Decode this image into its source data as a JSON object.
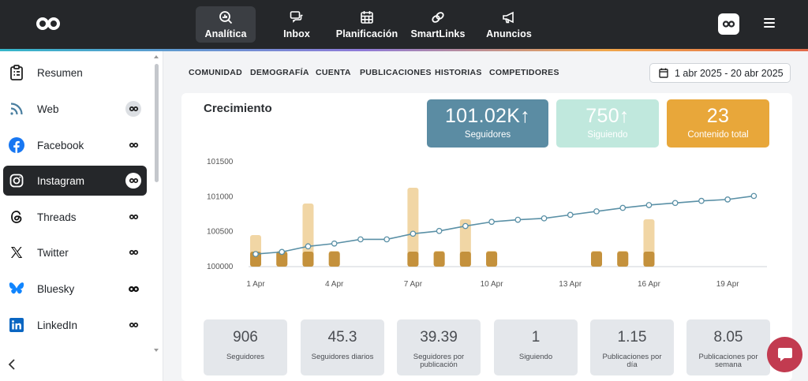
{
  "topnav": {
    "items": [
      {
        "label": "Analítica",
        "icon": "analytics-icon",
        "active": true
      },
      {
        "label": "Inbox",
        "icon": "inbox-icon"
      },
      {
        "label": "Planificación",
        "icon": "calendar-icon"
      },
      {
        "label": "SmartLinks",
        "icon": "link-icon"
      },
      {
        "label": "Anuncios",
        "icon": "megaphone-icon"
      }
    ]
  },
  "sidebar": {
    "items": [
      {
        "label": "Resumen",
        "icon": "clipboard-icon"
      },
      {
        "label": "Web",
        "icon": "rss-icon"
      },
      {
        "label": "Facebook",
        "icon": "facebook-icon"
      },
      {
        "label": "Instagram",
        "icon": "instagram-icon",
        "active": true
      },
      {
        "label": "Threads",
        "icon": "threads-icon"
      },
      {
        "label": "Twitter",
        "icon": "x-icon"
      },
      {
        "label": "Bluesky",
        "icon": "bluesky-icon"
      },
      {
        "label": "LinkedIn",
        "icon": "linkedin-icon"
      }
    ]
  },
  "subnav": {
    "tabs": [
      "COMUNIDAD",
      "DEMOGRAFÍA",
      "CUENTA",
      "PUBLICACIONES",
      "HISTORIAS",
      "COMPETIDORES"
    ],
    "date_range": "1 abr 2025 - 20 abr 2025"
  },
  "growth": {
    "title": "Crecimiento",
    "metrics": [
      {
        "value": "101.02K",
        "label": "Seguidores",
        "color": "#5b8ca3"
      },
      {
        "value": "750",
        "label": "Siguiendo",
        "color": "#c0e8dd"
      },
      {
        "value": "23",
        "label": "Contenido total",
        "color": "#e8a73a"
      }
    ]
  },
  "chart_data": {
    "type": "line",
    "title": "",
    "y_ticks": [
      "101500",
      "101000",
      "100500",
      "100000"
    ],
    "ylim": [
      100000,
      101500
    ],
    "x_ticks": [
      "1 Apr",
      "4 Apr",
      "7 Apr",
      "10 Apr",
      "13 Apr",
      "16 Apr",
      "19 Apr"
    ],
    "x": [
      "1 Apr",
      "2 Apr",
      "3 Apr",
      "4 Apr",
      "5 Apr",
      "6 Apr",
      "7 Apr",
      "8 Apr",
      "9 Apr",
      "10 Apr",
      "11 Apr",
      "12 Apr",
      "13 Apr",
      "14 Apr",
      "15 Apr",
      "16 Apr",
      "17 Apr",
      "18 Apr",
      "19 Apr",
      "20 Apr"
    ],
    "series": [
      {
        "values": [
          100180,
          100210,
          100290,
          100330,
          100390,
          100390,
          100470,
          100510,
          100580,
          100640,
          100670,
          100690,
          100740,
          100790,
          100840,
          100880,
          100910,
          100940,
          100960,
          101010
        ]
      },
      {
        "values": [
          2,
          1,
          4,
          1,
          0,
          0,
          5,
          1,
          3,
          1,
          0,
          0,
          0,
          1,
          1,
          3,
          0,
          0,
          0,
          0
        ]
      },
      {
        "values": [
          1,
          1,
          1,
          1,
          0,
          0,
          1,
          1,
          1,
          1,
          0,
          0,
          0,
          1,
          1,
          1,
          0,
          0,
          0,
          0
        ]
      }
    ],
    "colors": {
      "line": "#5a90a6",
      "bar_light": "#f1d6a5",
      "bar_dark": "#c4913c"
    }
  },
  "stats": [
    {
      "value": "906",
      "label": "Seguidores"
    },
    {
      "value": "45.3",
      "label": "Seguidores diarios"
    },
    {
      "value": "39.39",
      "label": "Seguidores por publicación"
    },
    {
      "value": "1",
      "label": "Siguiendo"
    },
    {
      "value": "1.15",
      "label": "Publicaciones por día"
    },
    {
      "value": "8.05",
      "label": "Publicaciones por semana"
    }
  ]
}
